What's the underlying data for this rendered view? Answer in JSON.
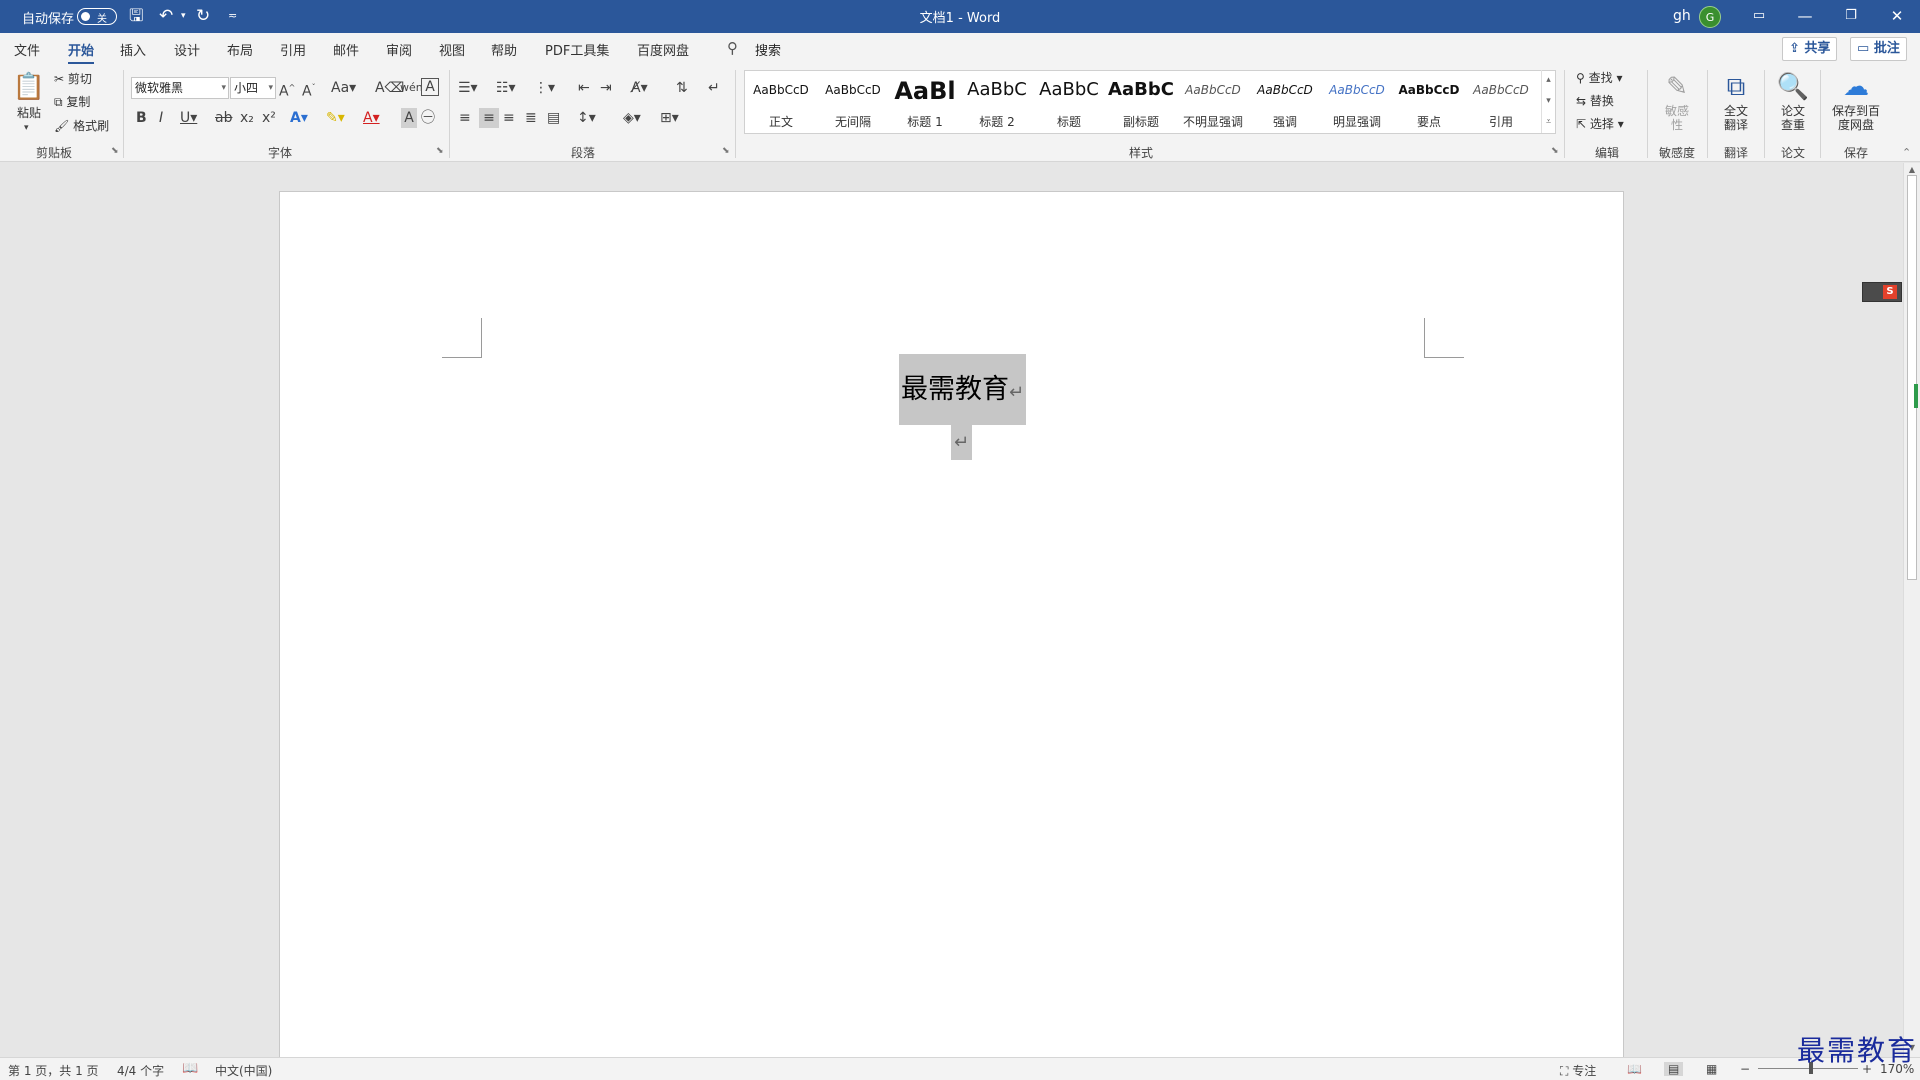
{
  "titlebar": {
    "autosave_label": "自动保存",
    "autosave_state": "关",
    "doc_title": "文档1  -  Word",
    "user_name": "gh",
    "user_initial": "G"
  },
  "tabs": [
    "文件",
    "开始",
    "插入",
    "设计",
    "布局",
    "引用",
    "邮件",
    "审阅",
    "视图",
    "帮助",
    "PDF工具集",
    "百度网盘"
  ],
  "search_label": "搜索",
  "share_label": "共享",
  "comment_label": "批注",
  "clipboard": {
    "paste": "粘贴",
    "cut": "剪切",
    "copy": "复制",
    "format_painter": "格式刷",
    "group": "剪贴板"
  },
  "font": {
    "name": "微软雅黑",
    "size": "小四",
    "group": "字体"
  },
  "paragraph": {
    "group": "段落"
  },
  "styles": {
    "group": "样式",
    "items": [
      {
        "sample": "AaBbCcD",
        "name": "正文"
      },
      {
        "sample": "AaBbCcD",
        "name": "无间隔"
      },
      {
        "sample": "AaBl",
        "name": "标题 1"
      },
      {
        "sample": "AaBbC",
        "name": "标题 2"
      },
      {
        "sample": "AaBbC",
        "name": "标题"
      },
      {
        "sample": "AaBbC",
        "name": "副标题"
      },
      {
        "sample": "AaBbCcD",
        "name": "不明显强调"
      },
      {
        "sample": "AaBbCcD",
        "name": "强调"
      },
      {
        "sample": "AaBbCcD",
        "name": "明显强调"
      },
      {
        "sample": "AaBbCcD",
        "name": "要点"
      },
      {
        "sample": "AaBbCcD",
        "name": "引用"
      }
    ]
  },
  "editing": {
    "find": "查找",
    "replace": "替换",
    "select": "选择",
    "group": "编辑"
  },
  "sensitivity": {
    "button": "敏感性",
    "group": "敏感度"
  },
  "translate": {
    "button": "全文翻译",
    "group": "翻译"
  },
  "paper": {
    "button": "论文查重",
    "group": "论文"
  },
  "save": {
    "button": "保存到百度网盘",
    "group": "保存"
  },
  "document": {
    "text": "最需教育",
    "para_mark": "↵"
  },
  "status": {
    "page": "第 1 页，共 1 页",
    "words": "4/4 个字",
    "language": "中文(中国)",
    "focus": "专注",
    "zoom": "170%",
    "zoom_fraction": 0.53
  },
  "watermark": "最需教育",
  "colors": {
    "accent": "#2b579a",
    "selection": "#c6c6c6"
  }
}
